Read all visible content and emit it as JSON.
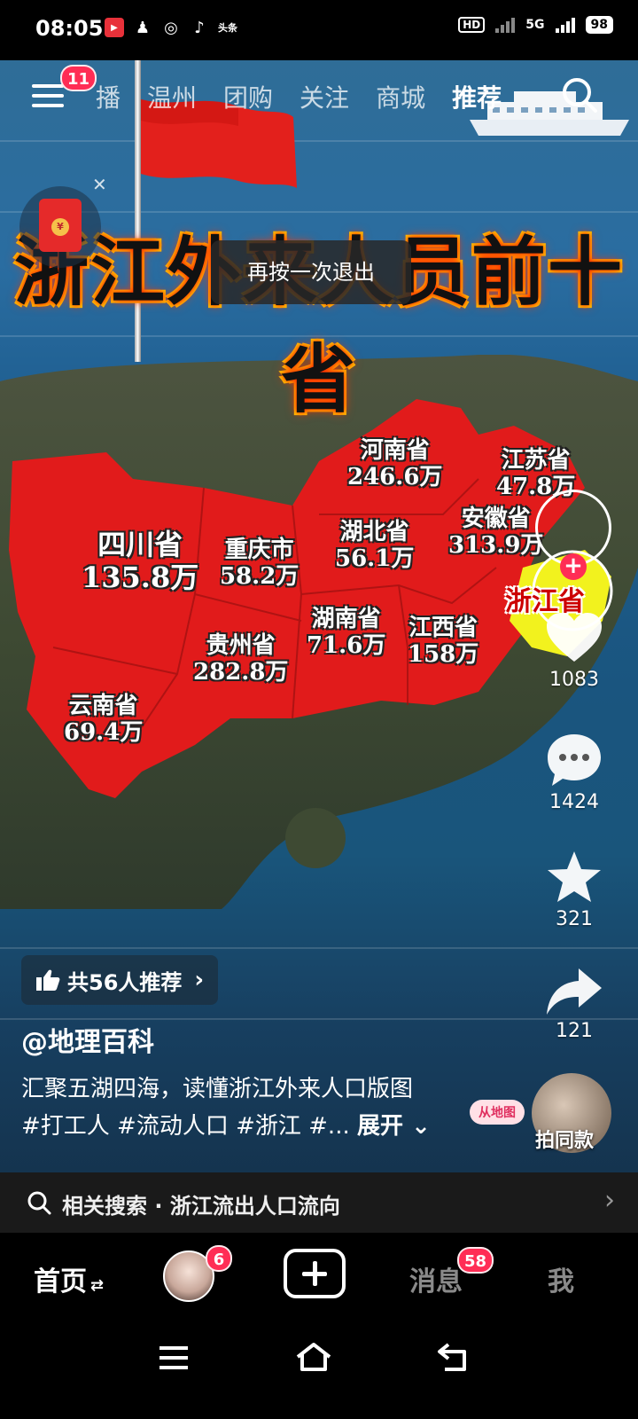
{
  "status_bar": {
    "time": "08:05",
    "network": "5G",
    "battery": "98",
    "hd_label": "HD",
    "app_icons": [
      "video-app",
      "qq",
      "weibo",
      "tiktok",
      "toutiao"
    ]
  },
  "top_nav": {
    "menu_badge": "11",
    "tabs": [
      "播",
      "温州",
      "团购",
      "关注",
      "商城",
      "推荐"
    ],
    "active_tab": "推荐"
  },
  "video": {
    "title": "浙江外来人员前十省",
    "toast": "再按一次退出",
    "map_labels": [
      {
        "name": "河南省",
        "value": "246.6万"
      },
      {
        "name": "江苏省",
        "value": "47.8万"
      },
      {
        "name": "安徽省",
        "value": "313.9万"
      },
      {
        "name": "湖北省",
        "value": "56.1万"
      },
      {
        "name": "四川省",
        "value": "135.8万"
      },
      {
        "name": "重庆市",
        "value": "58.2万"
      },
      {
        "name": "湖南省",
        "value": "71.6万"
      },
      {
        "name": "江西省",
        "value": "158万"
      },
      {
        "name": "贵州省",
        "value": "282.8万"
      },
      {
        "name": "云南省",
        "value": "69.4万"
      }
    ],
    "home_province": "浙江省"
  },
  "rail": {
    "likes": "1083",
    "comments": "1424",
    "favorites": "321",
    "shares": "121",
    "same_style": "拍同款",
    "tag_bubble": "从地图"
  },
  "post": {
    "recommend": "共56人推荐",
    "author": "@地理百科",
    "caption_line1": "汇聚五湖四海，读懂浙江外来人口版图",
    "caption_line2": "#打工人 #流动人口 #浙江 #... ",
    "expand": "展开"
  },
  "related_search": {
    "prefix": "相关搜索",
    "query": "浙江流出人口流向",
    "text": "相关搜索 · 浙江流出人口流向"
  },
  "bottom_nav": {
    "home": "首页",
    "friends_badge": "6",
    "messages": "消息",
    "messages_badge": "58",
    "me": "我"
  },
  "colors": {
    "accent": "#ff2d55",
    "map_red": "#e11b1b",
    "zhejiang_yellow": "#f2f21e"
  }
}
